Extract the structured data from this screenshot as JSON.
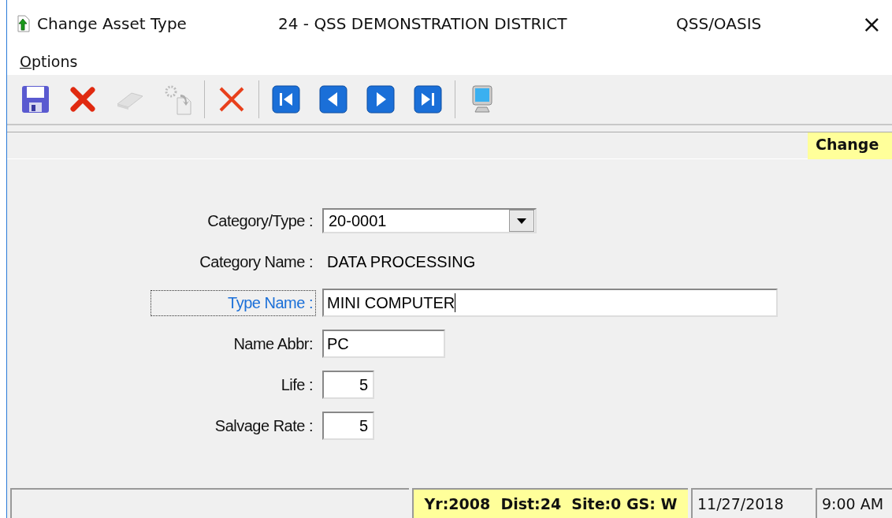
{
  "window": {
    "title": "Change Asset Type",
    "district": "24 - QSS DEMONSTRATION DISTRICT",
    "system": "QSS/OASIS",
    "close": "×"
  },
  "menu": [
    {
      "label": "Options"
    }
  ],
  "toolbar": [
    {
      "kind": "save",
      "disabled": false
    },
    {
      "kind": "cancel",
      "disabled": false
    },
    {
      "kind": "eraser",
      "disabled": true
    },
    {
      "kind": "copy",
      "disabled": true
    },
    {
      "kind": "sep"
    },
    {
      "kind": "delete",
      "disabled": false
    },
    {
      "kind": "sep"
    },
    {
      "kind": "first",
      "disabled": false
    },
    {
      "kind": "prev",
      "disabled": false
    },
    {
      "kind": "next",
      "disabled": false
    },
    {
      "kind": "last",
      "disabled": false
    },
    {
      "kind": "sep"
    },
    {
      "kind": "computer",
      "disabled": false
    }
  ],
  "mode_badge": "Change",
  "fields": [
    {
      "kind": "combo",
      "label": "Category/Type :",
      "value": "20-0001",
      "focused": false
    },
    {
      "kind": "readonly",
      "label": "Category Name :",
      "value": "DATA PROCESSING",
      "focused": false
    },
    {
      "kind": "text",
      "label": "Type Name :",
      "value": "MINI COMPUTER",
      "focused": true
    },
    {
      "kind": "short",
      "label": "Name Abbr:",
      "value": "PC",
      "focused": false
    },
    {
      "kind": "number",
      "label": "Life :",
      "value": "5",
      "focused": false
    },
    {
      "kind": "number",
      "label": "Salvage Rate :",
      "value": "5",
      "focused": false
    }
  ],
  "status_bar": {
    "context": "Yr:2008  Dist:24  Site:0 GS: W",
    "date": "11/27/2018",
    "time": "9:00 AM"
  }
}
